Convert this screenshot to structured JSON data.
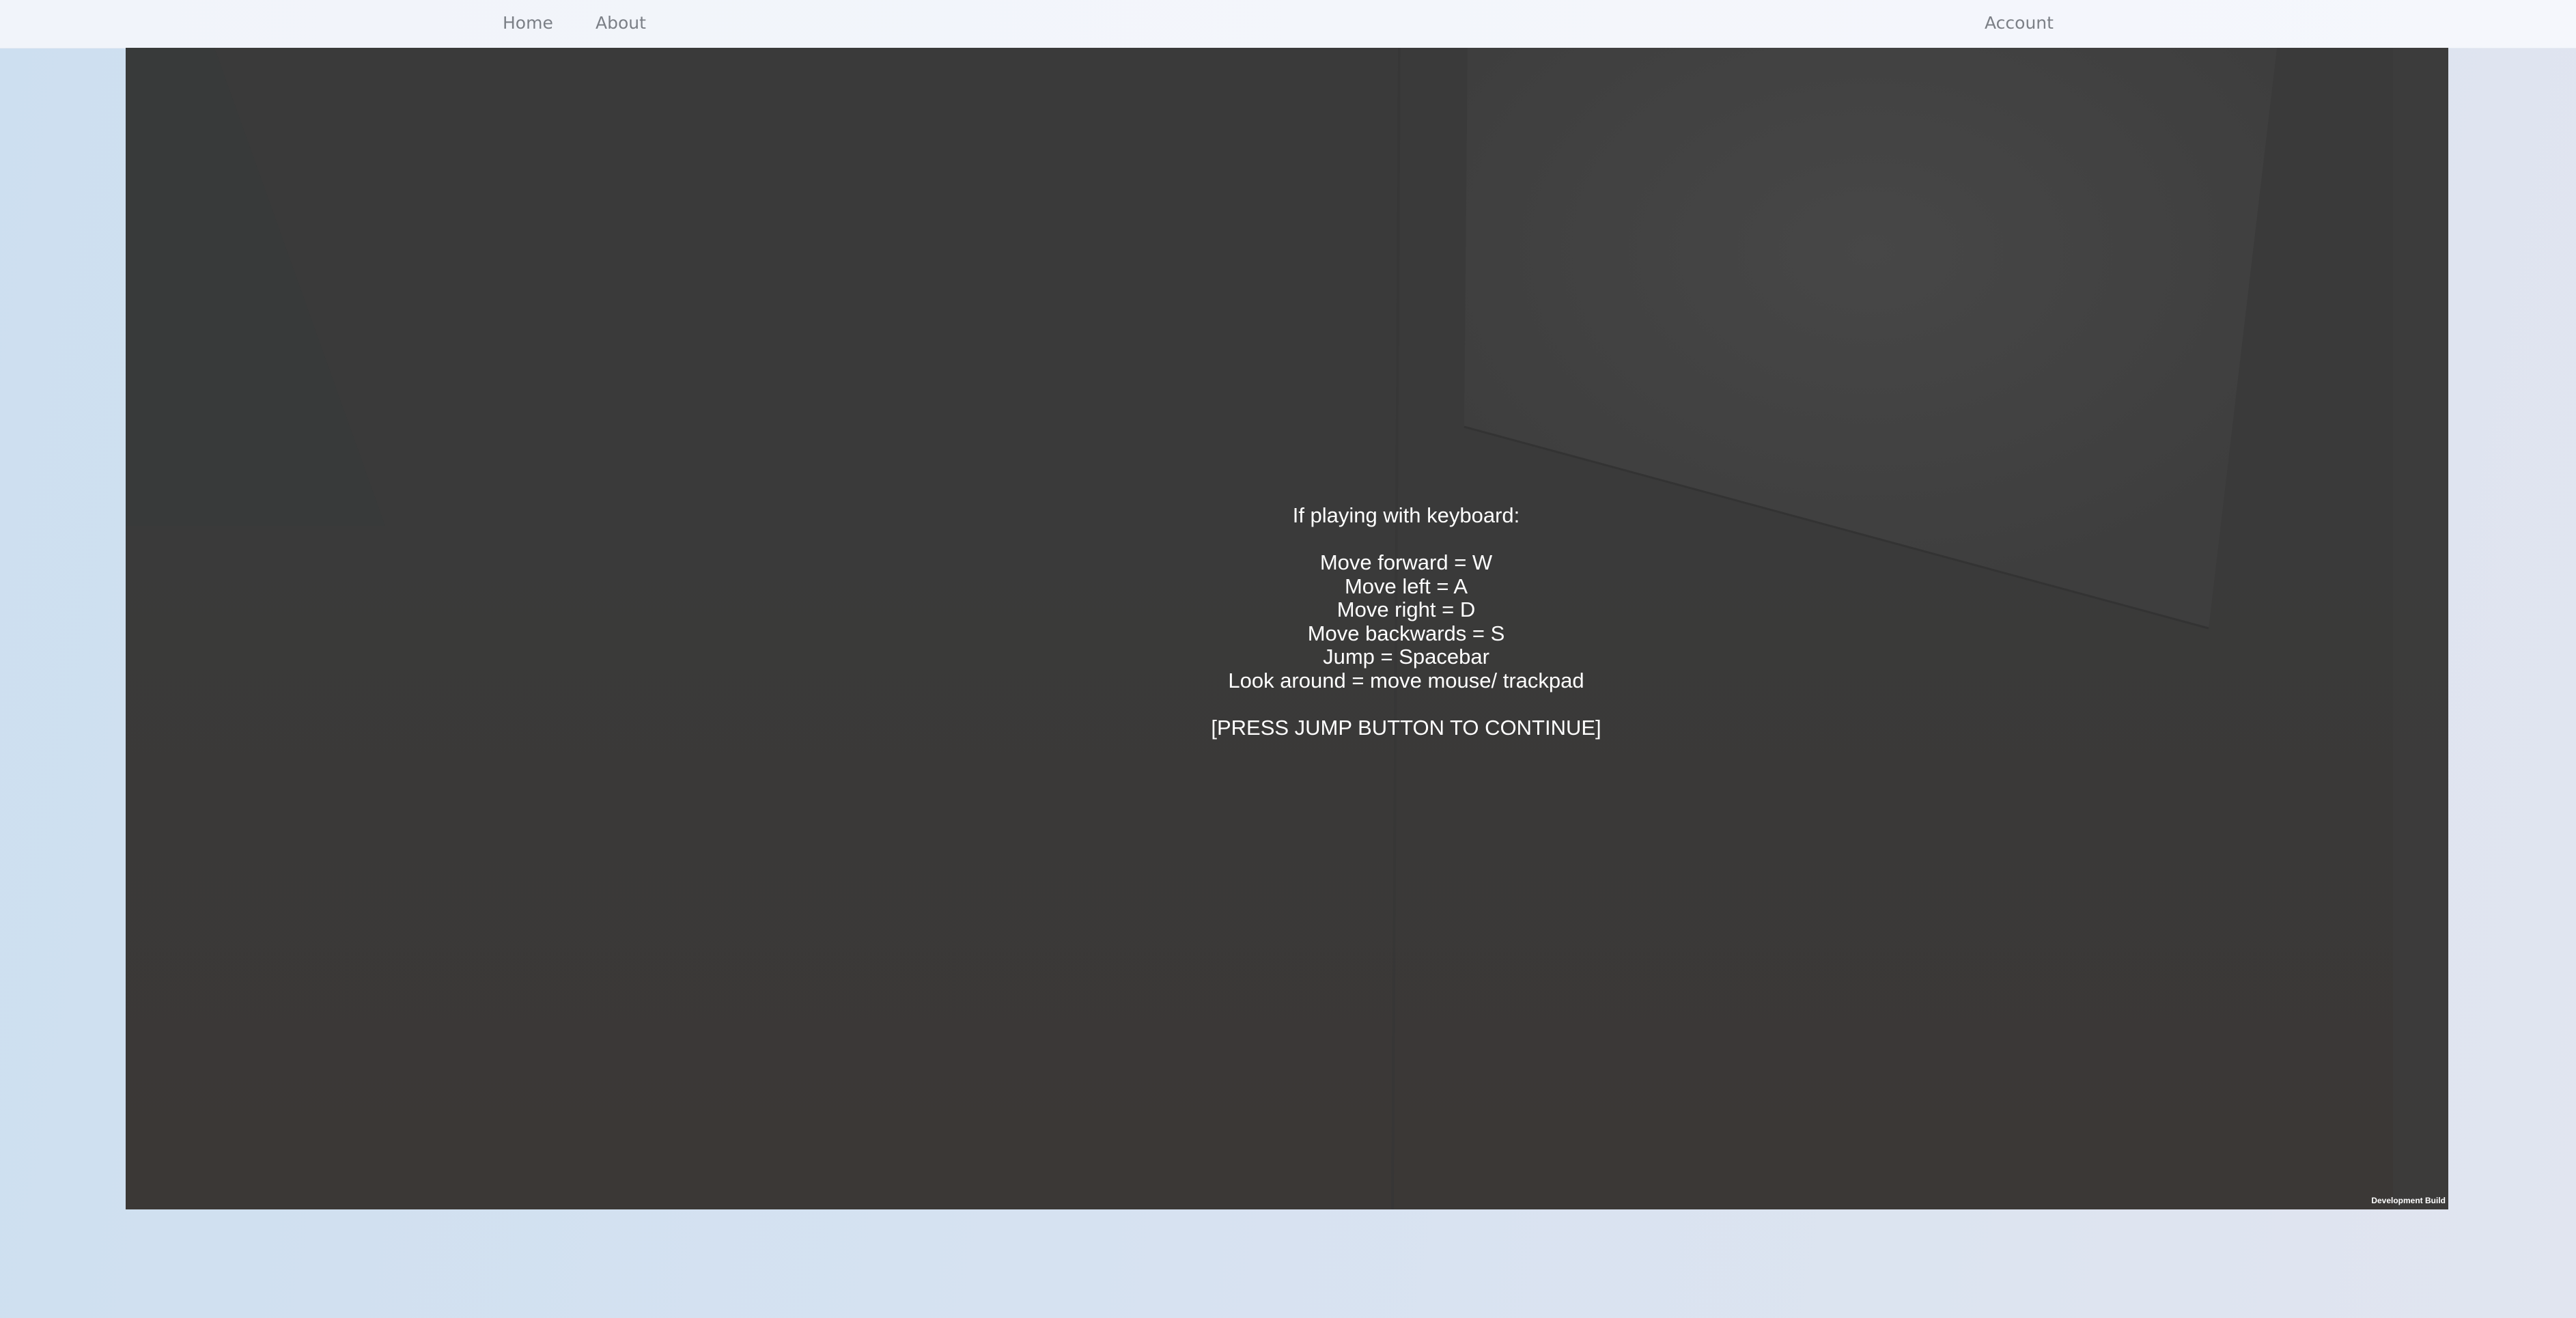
{
  "nav": {
    "home_label": "Home",
    "about_label": "About",
    "account_label": "Account"
  },
  "game": {
    "intro": "If playing with keyboard:",
    "controls": [
      "Move forward = W",
      "Move left = A",
      "Move right = D",
      "Move backwards = S",
      "Jump = Spacebar",
      "Look around = move mouse/ trackpad"
    ],
    "continue_prompt": "[PRESS JUMP BUTTON TO CONTINUE]",
    "build_label": "Development Build"
  },
  "colors": {
    "page_background": "#d6e2f1",
    "navbar_background": "#f3f6fb",
    "nav_text": "#7b7f86",
    "game_background": "#3a3a3a",
    "overlay_text": "#ffffff"
  }
}
